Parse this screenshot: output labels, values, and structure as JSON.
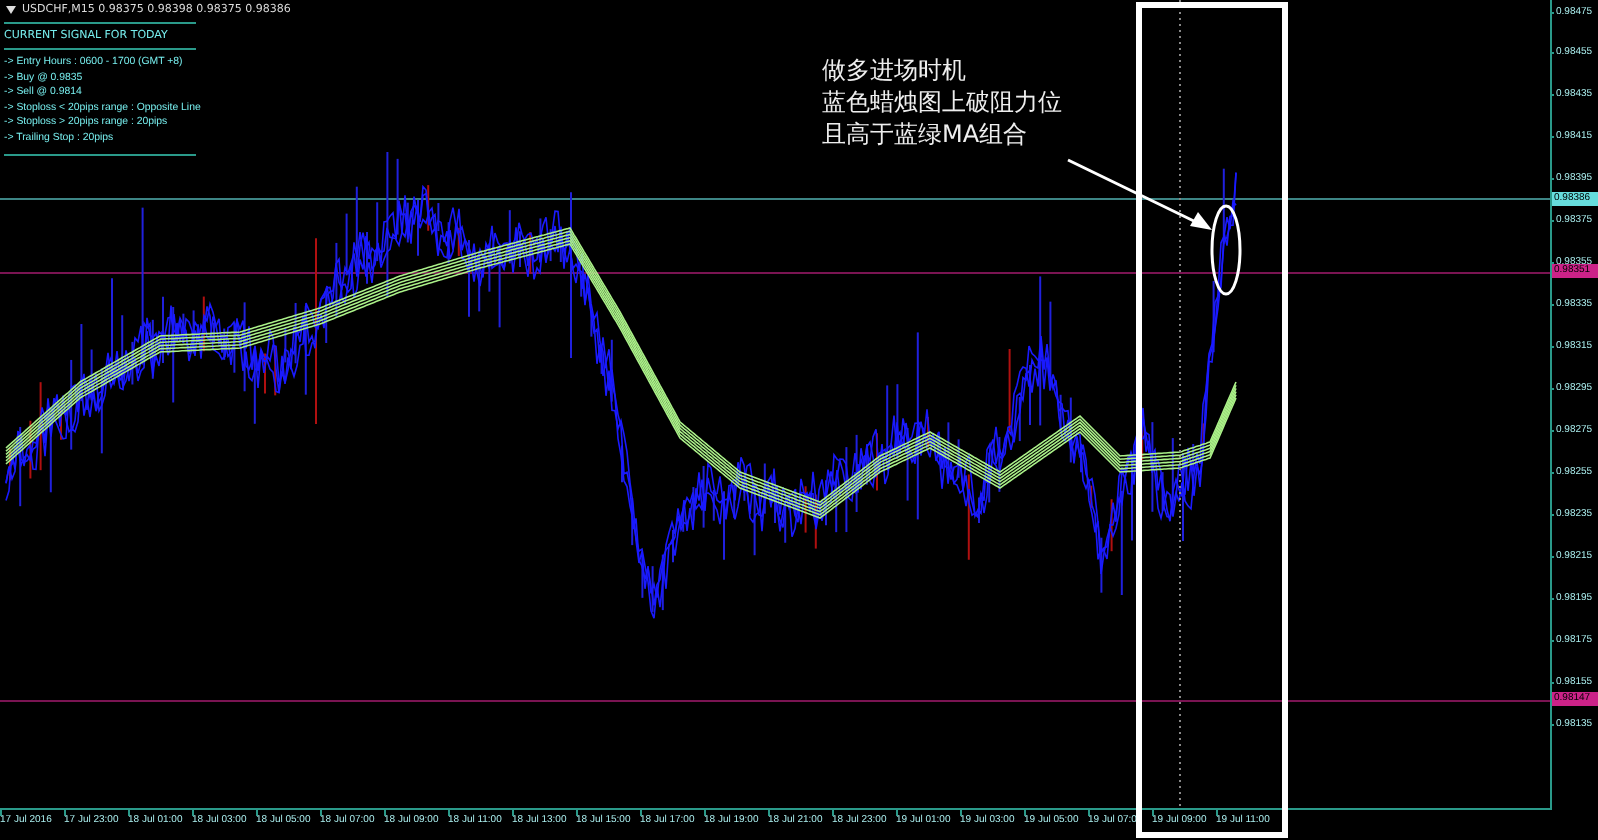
{
  "title": "USDCHF,M15  0.98375 0.98398 0.98375 0.98386",
  "signal_panel": {
    "heading": "CURRENT SIGNAL FOR TODAY",
    "lines": [
      "-> Entry Hours : 0600 - 1700 (GMT +8)",
      "-> Buy @ 0.9835",
      "-> Sell @ 0.9814",
      "-> Stoploss < 20pips range : Opposite Line",
      "-> Stoploss > 20pips range : 20pips",
      "-> Trailing Stop : 20pips"
    ]
  },
  "annotation": {
    "lines": [
      "做多进场时机",
      "蓝色蜡烛图上破阻力位",
      "且高于蓝绿MA组合"
    ]
  },
  "price_axis": {
    "labels": [
      "0.98475",
      "0.98455",
      "0.98435",
      "0.98415",
      "0.98395",
      "0.98375",
      "0.98355",
      "0.98335",
      "0.98315",
      "0.98295",
      "0.98275",
      "0.98255",
      "0.98235",
      "0.98215",
      "0.98195",
      "0.98175",
      "0.98155",
      "0.98135"
    ],
    "markers": [
      {
        "label": "0.98386",
        "color": "#66dddd"
      },
      {
        "label": "0.98351",
        "color": "#cc2288"
      },
      {
        "label": "0.98147",
        "color": "#cc2288"
      }
    ]
  },
  "time_axis": {
    "labels": [
      "17 Jul 2016",
      "17 Jul 23:00",
      "18 Jul 01:00",
      "18 Jul 03:00",
      "18 Jul 05:00",
      "18 Jul 07:00",
      "18 Jul 09:00",
      "18 Jul 11:00",
      "18 Jul 13:00",
      "18 Jul 15:00",
      "18 Jul 17:00",
      "18 Jul 19:00",
      "18 Jul 21:00",
      "18 Jul 23:00",
      "19 Jul 01:00",
      "19 Jul 03:00",
      "19 Jul 05:00",
      "19 Jul 07:0",
      "19 Jul 09:00",
      "19 Jul 11:00"
    ]
  }
}
